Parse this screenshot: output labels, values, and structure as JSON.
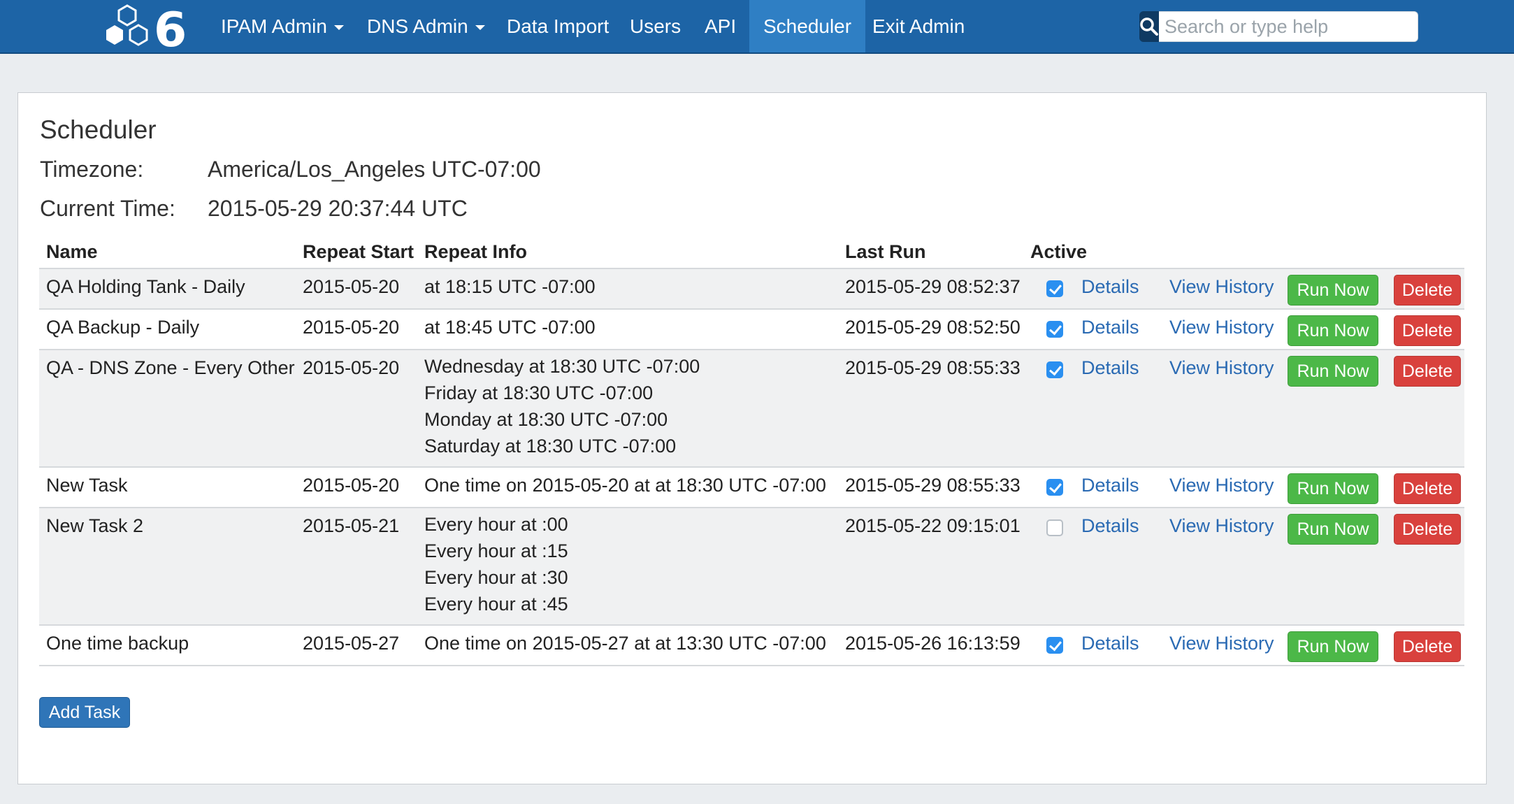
{
  "nav": {
    "items": [
      {
        "label": "IPAM Admin",
        "dropdown": true
      },
      {
        "label": "DNS Admin",
        "dropdown": true
      },
      {
        "label": "Data Import",
        "dropdown": false
      },
      {
        "label": "Users",
        "dropdown": false
      },
      {
        "label": "API",
        "dropdown": false
      },
      {
        "label": "Scheduler",
        "dropdown": false,
        "active": true
      },
      {
        "label": "Exit Admin",
        "dropdown": false
      }
    ],
    "search_placeholder": "Search or type help"
  },
  "page": {
    "title": "Scheduler",
    "timezone_label": "Timezone:",
    "timezone_value": "America/Los_Angeles UTC-07:00",
    "current_time_label": "Current Time:",
    "current_time_value": "2015-05-29 20:37:44 UTC"
  },
  "table": {
    "headers": {
      "name": "Name",
      "repeat_start": "Repeat Start",
      "repeat_info": "Repeat Info",
      "last_run": "Last Run",
      "active": "Active"
    },
    "action_labels": {
      "details": "Details",
      "view_history": "View History",
      "run_now": "Run Now",
      "delete": "Delete"
    },
    "rows": [
      {
        "name": "QA Holding Tank - Daily",
        "repeat_start": "2015-05-20",
        "repeat_info": [
          "at 18:15 UTC -07:00"
        ],
        "last_run": "2015-05-29 08:52:37",
        "active": true
      },
      {
        "name": "QA Backup - Daily",
        "repeat_start": "2015-05-20",
        "repeat_info": [
          "at 18:45 UTC -07:00"
        ],
        "last_run": "2015-05-29 08:52:50",
        "active": true
      },
      {
        "name": "QA - DNS Zone - Every Other",
        "repeat_start": "2015-05-20",
        "repeat_info": [
          "Wednesday at 18:30 UTC -07:00",
          "Friday at 18:30 UTC -07:00",
          "Monday at 18:30 UTC -07:00",
          "Saturday at 18:30 UTC -07:00"
        ],
        "last_run": "2015-05-29 08:55:33",
        "active": true
      },
      {
        "name": "New Task",
        "repeat_start": "2015-05-20",
        "repeat_info": [
          "One time on 2015-05-20 at at 18:30 UTC -07:00"
        ],
        "last_run": "2015-05-29 08:55:33",
        "active": true
      },
      {
        "name": "New Task 2",
        "repeat_start": "2015-05-21",
        "repeat_info": [
          "Every hour at :00",
          "Every hour at :15",
          "Every hour at :30",
          "Every hour at :45"
        ],
        "last_run": "2015-05-22 09:15:01",
        "active": false
      },
      {
        "name": "One time backup",
        "repeat_start": "2015-05-27",
        "repeat_info": [
          "One time on 2015-05-27 at at 13:30 UTC -07:00"
        ],
        "last_run": "2015-05-26 16:13:59",
        "active": true
      }
    ]
  },
  "add_task_label": "Add Task",
  "colors": {
    "navbar": "#1d64a6",
    "nav_active": "#2f7fc4",
    "link": "#2a6ab3",
    "run_button": "#4cb848",
    "delete_button": "#d9413d",
    "primary_button": "#2f75b8",
    "checkbox_checked": "#2a8ff0"
  }
}
